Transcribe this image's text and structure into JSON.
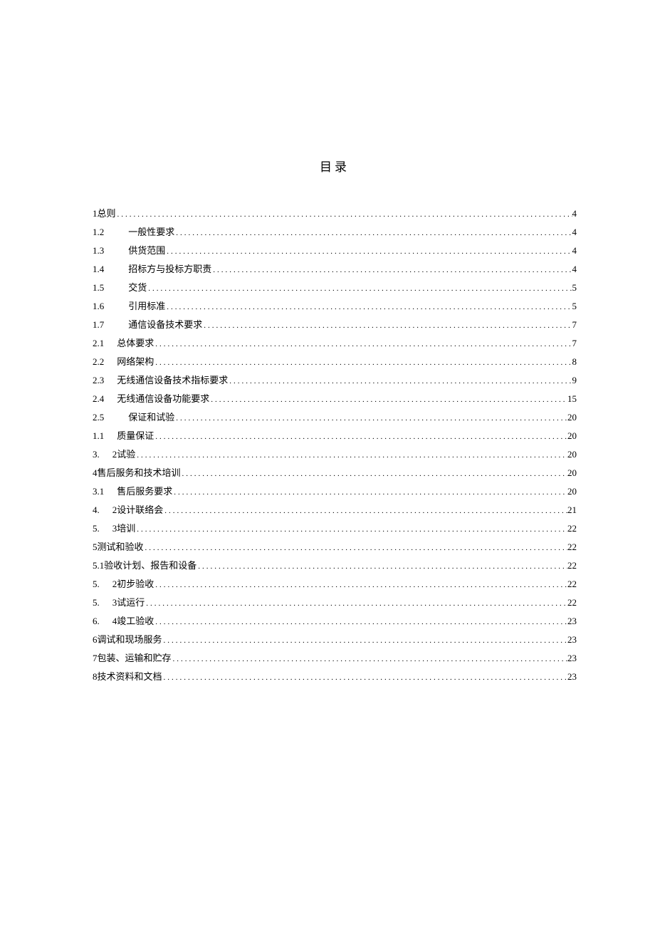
{
  "title": "目录",
  "entries": [
    {
      "num": "1总则",
      "gap": "",
      "text": " ",
      "page": "4"
    },
    {
      "num": "1.2",
      "gap": "m",
      "text": "一般性要求 ",
      "page": "4"
    },
    {
      "num": "1.3",
      "gap": "m",
      "text": "供货范围 ",
      "page": "4"
    },
    {
      "num": "1.4",
      "gap": "m",
      "text": "招标方与投标方职责 ",
      "page": "4"
    },
    {
      "num": "1.5",
      "gap": "m",
      "text": "交货 ",
      "page": "5"
    },
    {
      "num": "1.6",
      "gap": "m",
      "text": "引用标准 ",
      "page": "5"
    },
    {
      "num": "1.7",
      "gap": "m",
      "text": "  通信设备技术要求 ",
      "page": "7"
    },
    {
      "num": "2.1",
      "gap": "s",
      "text": "总体要求",
      "page": "7"
    },
    {
      "num": "2.2",
      "gap": "s",
      "text": "网络架构",
      "page": " 8"
    },
    {
      "num": "2.3",
      "gap": "s",
      "text": "无线通信设备技术指标要求",
      "page": " 9"
    },
    {
      "num": "2.4",
      "gap": "s",
      "text": "无线通信设备功能要求",
      "page": "15"
    },
    {
      "num": "2.5",
      "gap": "m",
      "text": "  保证和试验 ",
      "page": "20"
    },
    {
      "num": "1.1",
      "gap": "s",
      "text": "质量保证 ",
      "page": "20"
    },
    {
      "num": "3.",
      "gap": "s",
      "text": "2试验",
      "page": "20"
    },
    {
      "num": "4售后服务和技术培训 ",
      "gap": "",
      "text": "",
      "page": "20"
    },
    {
      "num": "3.1",
      "gap": "s",
      "text": "售后服务要求 ",
      "page": "20"
    },
    {
      "num": "4.",
      "gap": "s",
      "text": "2设计联络会",
      "page": "21"
    },
    {
      "num": "5.",
      "gap": "s",
      "text": "3培训",
      "page": "22"
    },
    {
      "num": "5测试和验收 ",
      "gap": "",
      "text": "",
      "page": "22"
    },
    {
      "num": "5.1验收计划、报告和设备",
      "gap": "",
      "text": "",
      "page": "22"
    },
    {
      "num": "5.",
      "gap": "s",
      "text": "2初步验收",
      "page": "22"
    },
    {
      "num": "5.",
      "gap": "s",
      "text": "3试运行",
      "page": "22"
    },
    {
      "num": "6.",
      "gap": "s",
      "text": "4竣工验收",
      "page": "23"
    },
    {
      "num": "6调试和现场服务 ",
      "gap": "",
      "text": "",
      "page": "23"
    },
    {
      "num": "7包装、运输和贮存 ",
      "gap": "",
      "text": "",
      "page": "23"
    },
    {
      "num": "8技术资料和文档 ",
      "gap": "",
      "text": "",
      "page": "23"
    }
  ]
}
